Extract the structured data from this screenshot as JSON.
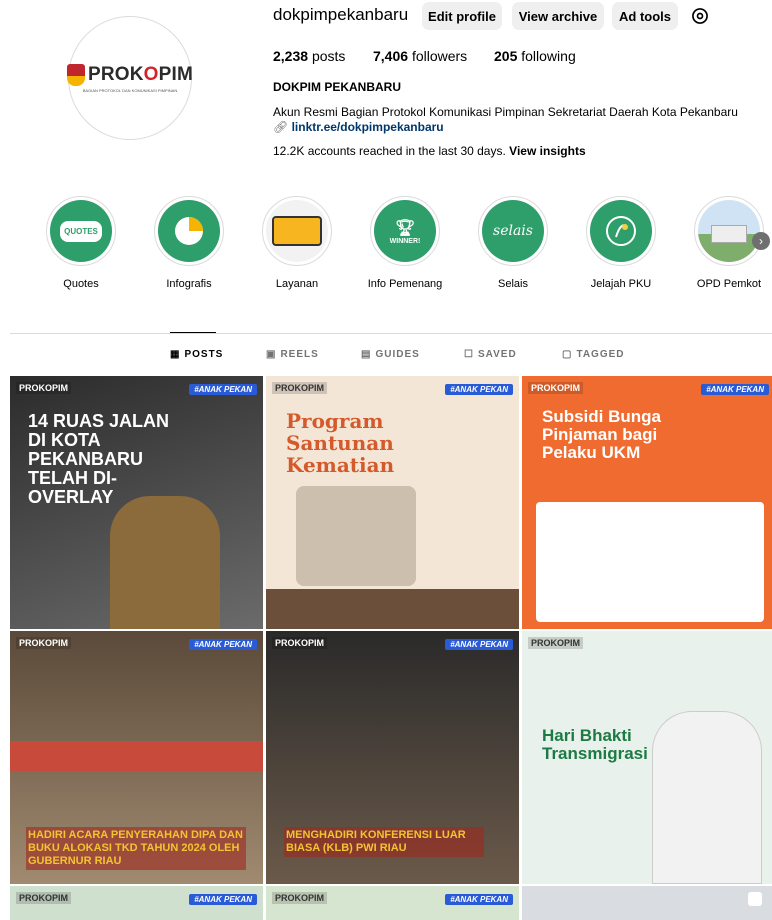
{
  "profile": {
    "username": "dokpimpekanbaru",
    "posts_count": "2,238",
    "posts_label": "posts",
    "followers_count": "7,406",
    "followers_label": "followers",
    "following_count": "205",
    "following_label": "following",
    "full_name": "DOKPIM PEKANBARU",
    "bio": "Akun Resmi Bagian Protokol Komunikasi Pimpinan Sekretariat Daerah Kota Pekanbaru",
    "link": "linktr.ee/dokpimpekanbaru",
    "reach_text": "12.2K accounts reached in the last 30 days.",
    "reach_link": "View insights",
    "logo_text_a": "PROK",
    "logo_text_o": "O",
    "logo_text_b": "PIM",
    "logo_subtext": "BAGIAN PROTOKOL DAN KOMUNIKASI PIMPINAN"
  },
  "buttons": {
    "edit_profile": "Edit profile",
    "view_archive": "View archive",
    "ad_tools": "Ad tools"
  },
  "highlights": [
    {
      "label": "Quotes",
      "color": "#2e9e6b",
      "icon_text": "QUOTES"
    },
    {
      "label": "Infografis",
      "color": "#2e9e6b",
      "icon_text": ""
    },
    {
      "label": "Layanan",
      "color": "#ffffff",
      "icon_text": ""
    },
    {
      "label": "Info Pemenang",
      "color": "#2e9e6b",
      "icon_text": "WINNER!"
    },
    {
      "label": "Selais",
      "color": "#2e9e6b",
      "icon_text": "selais"
    },
    {
      "label": "Jelajah PKU",
      "color": "#2e9e6b",
      "icon_text": ""
    },
    {
      "label": "OPD Pemkot",
      "color": "#cfe3f5",
      "icon_text": ""
    }
  ],
  "tabs": [
    "POSTS",
    "REELS",
    "GUIDES",
    "SAVED",
    "TAGGED"
  ],
  "posts": [
    {
      "title": "14 RUAS JALAN DI KOTA PEKANBARU TELAH DI-OVERLAY",
      "brand": "PROKOPIM",
      "bg": "#3a3a3a"
    },
    {
      "title": "Program Santunan Kematian",
      "brand": "PROKOPIM",
      "bg": "#f3e6d6"
    },
    {
      "title": "Subsidi Bunga Pinjaman bagi Pelaku UKM",
      "brand": "PROKOPIM",
      "bg": "#f06b2f"
    },
    {
      "title": "HADIRI ACARA PENYERAHAN DIPA DAN BUKU ALOKASI TKD TAHUN 2024 OLEH GUBERNUR RIAU",
      "brand": "PROKOPIM",
      "bg": "#7a6a55"
    },
    {
      "title": "MENGHADIRI KONFERENSI LUAR BIASA (KLB) PWI RIAU",
      "brand": "PROKOPIM",
      "bg": "#4a4038"
    },
    {
      "title": "Hari Bhakti Transmigrasi",
      "brand": "PROKOPIM",
      "bg": "#e9f1ec"
    },
    {
      "title": "",
      "brand": "PROKOPIM",
      "bg": "#cfe0cf"
    },
    {
      "title": "",
      "brand": "PROKOPIM",
      "bg": "#d6e5cf"
    },
    {
      "title": "",
      "brand": "",
      "bg": "#d9dde2"
    }
  ],
  "anak_tag": "#ANAK PEKAN",
  "accent": "#00376b"
}
